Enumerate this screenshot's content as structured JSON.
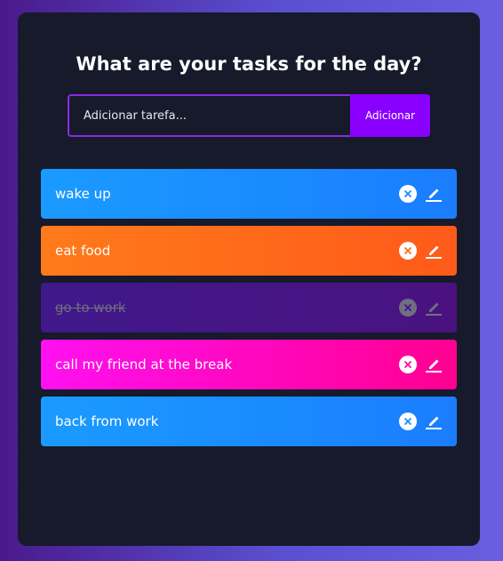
{
  "header": {
    "title": "What are your tasks for the day?"
  },
  "form": {
    "input_placeholder": "Adicionar tarefa...",
    "input_value": "",
    "add_button_label": "Adicionar"
  },
  "tasks": [
    {
      "text": "wake up",
      "color": "blue",
      "completed": false
    },
    {
      "text": "eat food",
      "color": "orange",
      "completed": false
    },
    {
      "text": "go to work",
      "color": "purple",
      "completed": true
    },
    {
      "text": "call my friend at the break",
      "color": "pink",
      "completed": false
    },
    {
      "text": "back from work",
      "color": "blue",
      "completed": false
    }
  ],
  "colors": {
    "blue": "#1a8dff",
    "orange": "#ff6a1a",
    "pink": "#ff08c8",
    "purple": "#44158a",
    "accent": "#8a00ff",
    "panel": "#161a2b"
  },
  "icons": {
    "delete": "close-circle-icon",
    "edit": "pencil-icon"
  }
}
